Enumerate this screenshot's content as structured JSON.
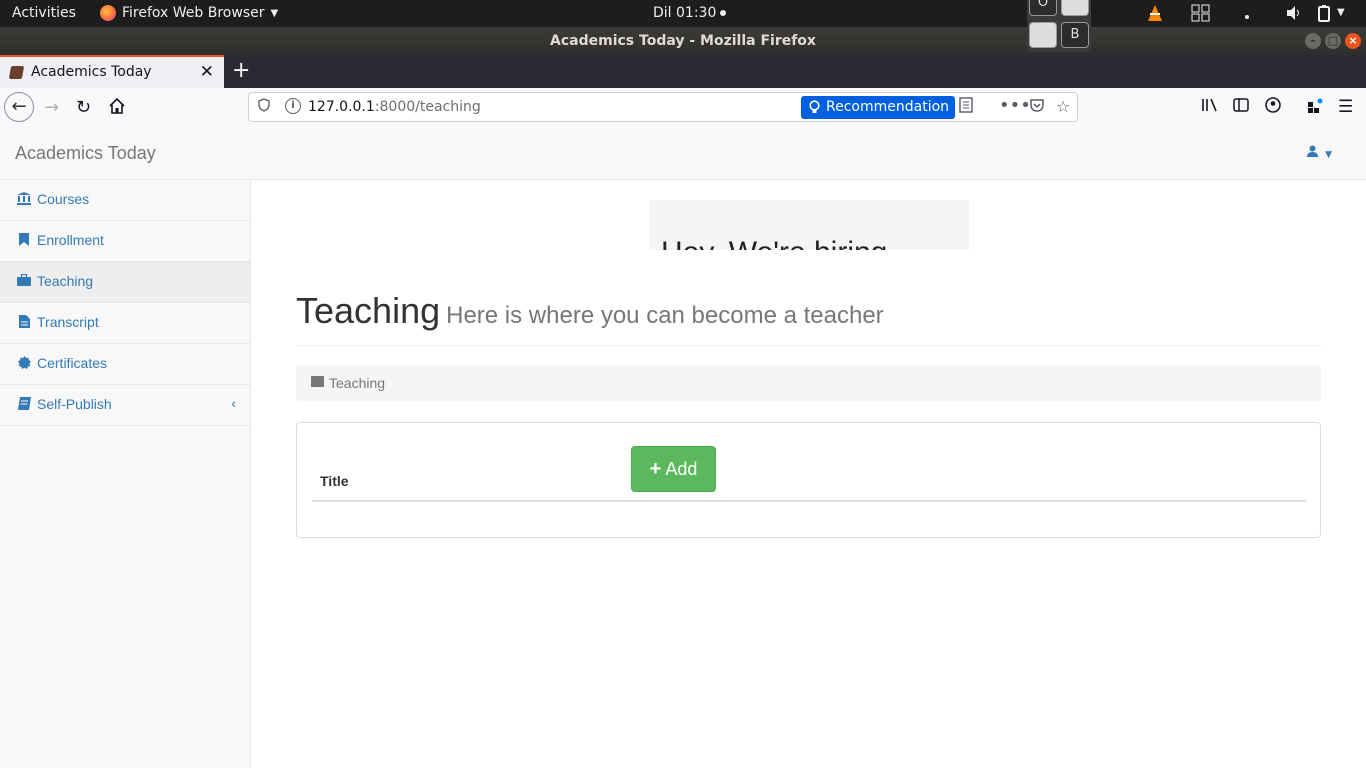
{
  "system": {
    "activities": "Activities",
    "app_name": "Firefox Web Browser",
    "clock": "Dil 01:30",
    "workspace_labels": [
      "O",
      "",
      "",
      "B"
    ]
  },
  "window": {
    "title": "Academics Today - Mozilla Firefox"
  },
  "browser": {
    "tab_title": "Academics Today",
    "url_host": "127.0.0.1",
    "url_rest": ":8000/teaching",
    "recommendation_label": "Recommendation"
  },
  "app": {
    "brand": "Academics Today"
  },
  "sidebar": {
    "items": [
      {
        "label": "Courses",
        "icon": "bank-icon"
      },
      {
        "label": "Enrollment",
        "icon": "bookmark-icon"
      },
      {
        "label": "Teaching",
        "icon": "briefcase-icon"
      },
      {
        "label": "Transcript",
        "icon": "file-icon"
      },
      {
        "label": "Certificates",
        "icon": "certificate-icon"
      },
      {
        "label": "Self-Publish",
        "icon": "book-icon"
      }
    ]
  },
  "main": {
    "banner_text": "Hey, We're hiring",
    "heading": "Teaching",
    "subheading": "Here is where you can become a teacher",
    "breadcrumb": "Teaching",
    "table": {
      "columns": [
        "Title"
      ],
      "add_label": "Add"
    }
  },
  "colors": {
    "link": "#337ab7",
    "success": "#5cb85c",
    "firefox_accent": "#0060df",
    "ubuntu_orange": "#e95420"
  }
}
